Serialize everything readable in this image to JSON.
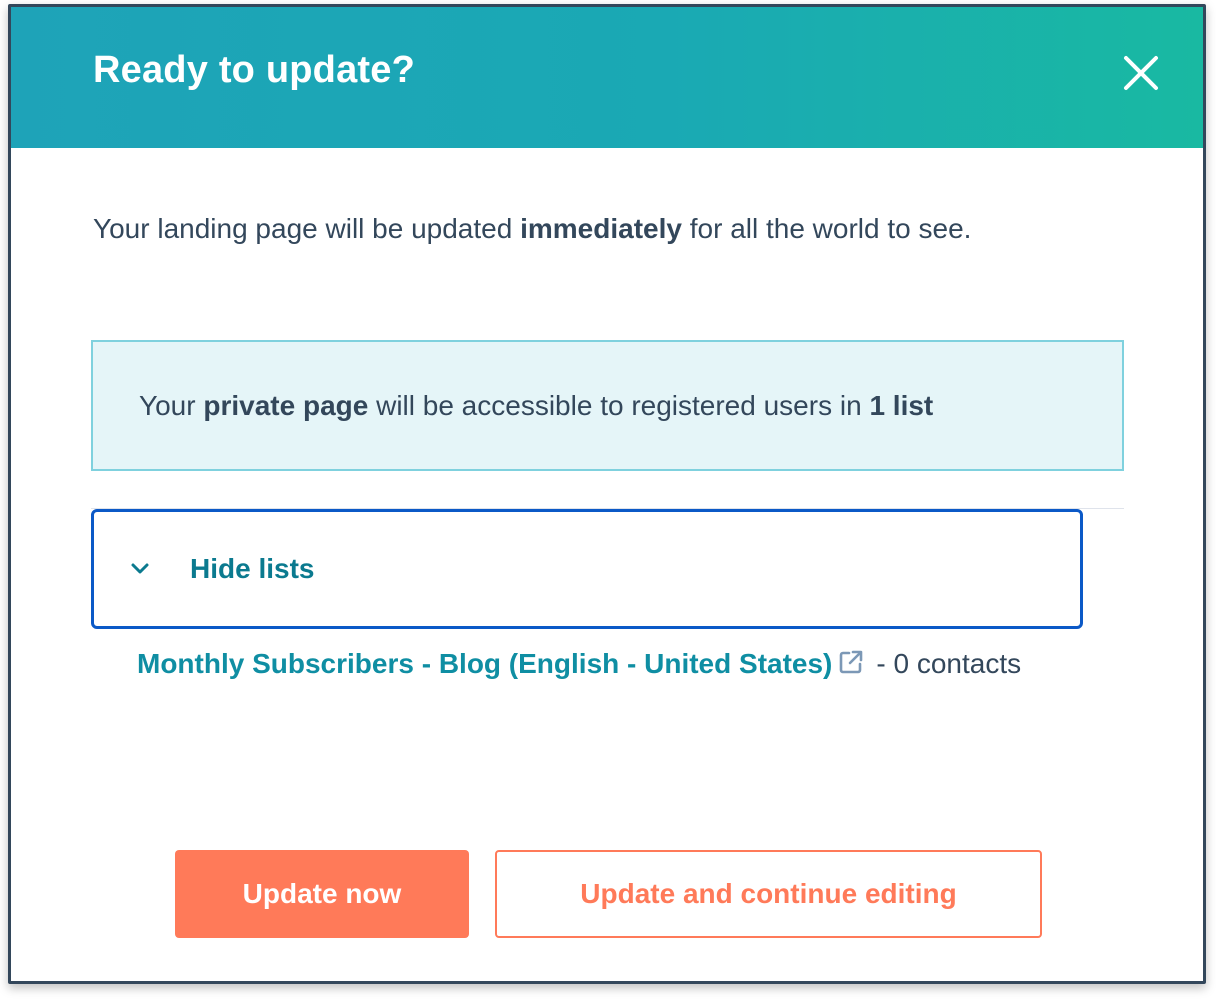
{
  "dialog": {
    "title": "Ready to update?",
    "close_icon": "close-icon"
  },
  "message": {
    "before": "Your landing page will be updated ",
    "emphasis": "immediately",
    "after": " for all the world to see."
  },
  "info": {
    "before": "Your ",
    "bold_1": "private page",
    "middle": " will be accessible to registered users in ",
    "bold_2": "1 list"
  },
  "lists_toggle": {
    "label": "Hide lists",
    "icon": "chevron-down-icon"
  },
  "lists": [
    {
      "name": "Monthly Subscribers - Blog (English - United States)",
      "icon": "external-link-icon",
      "count_text": "- 0 contacts"
    }
  ],
  "actions": {
    "primary_label": "Update now",
    "secondary_label": "Update and continue editing"
  },
  "colors": {
    "header_start": "#1ea3b8",
    "header_end": "#19b9a2",
    "text": "#33475b",
    "link": "#0f8ea3",
    "accent": "#ff7a59",
    "focus": "#0b59c7",
    "info_bg": "#e5f5f8",
    "info_border": "#7fd1de"
  }
}
